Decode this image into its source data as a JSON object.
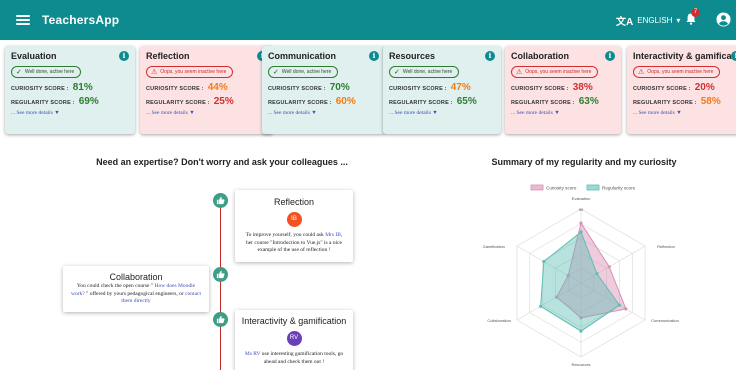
{
  "appbar": {
    "title": "TeachersApp",
    "language": "ENGLISH",
    "notification_count": "7"
  },
  "cards": [
    {
      "name": "Evaluation",
      "status": "good",
      "status_text": "Well done, active here",
      "curiosity_label": "CURIOSITY SCORE :",
      "curiosity": "81%",
      "curiosity_color": "green",
      "regularity_label": "REGULARITY SCORE :",
      "regularity": "69%",
      "regularity_color": "green",
      "more": "... See more details"
    },
    {
      "name": "Reflection",
      "status": "bad",
      "status_text": "Oops, you seem inactive here",
      "curiosity_label": "CURIOSITY SCORE :",
      "curiosity": "44%",
      "curiosity_color": "orange",
      "regularity_label": "REGULARITY SCORE :",
      "regularity": "25%",
      "regularity_color": "red",
      "more": "... See more details"
    },
    {
      "name": "Communication",
      "status": "good",
      "status_text": "Well done, active here",
      "curiosity_label": "CURIOSITY SCORE :",
      "curiosity": "70%",
      "curiosity_color": "green",
      "regularity_label": "REGULARITY SCORE :",
      "regularity": "60%",
      "regularity_color": "orange",
      "more": "... See more details"
    },
    {
      "name": "Resources",
      "status": "good",
      "status_text": "Well done, active here",
      "curiosity_label": "CURIOSITY SCORE :",
      "curiosity": "47%",
      "curiosity_color": "orange",
      "regularity_label": "REGULARITY SCORE :",
      "regularity": "65%",
      "regularity_color": "green",
      "more": "... See more details"
    },
    {
      "name": "Collaboration",
      "status": "bad",
      "status_text": "Oops, you seem inactive here",
      "curiosity_label": "CURIOSITY SCORE :",
      "curiosity": "38%",
      "curiosity_color": "red",
      "regularity_label": "REGULARITY SCORE :",
      "regularity": "63%",
      "regularity_color": "green",
      "more": "... See more details"
    },
    {
      "name": "Interactivity & gamification",
      "status": "bad",
      "status_text": "Oops, you seem inactive here",
      "curiosity_label": "CURIOSITY SCORE :",
      "curiosity": "20%",
      "curiosity_color": "red",
      "regularity_label": "REGULARITY SCORE :",
      "regularity": "58%",
      "regularity_color": "orange",
      "more": "... See more details"
    }
  ],
  "left_heading": "Need an expertise? Don't worry and ask your colleagues ...",
  "right_heading": "Summary of my regularity and my curiosity",
  "timeline": {
    "reflection": {
      "title": "Reflection",
      "avatar": "IB",
      "avatar_color": "#f4511e",
      "text_before": "To improve yourself, you could ask ",
      "link": "Mrs IB",
      "text_after": ", her course \"Introduction to Vue.js\" is a nice example of the use of reflection !"
    },
    "collaboration": {
      "title": "Collaboration",
      "text_before": "You could check the open course \" ",
      "link1": "How does Moodle work?",
      "text_middle": " \" offered by yours pedagogical engineers, or ",
      "link2": "contact them directly"
    },
    "interactivity": {
      "title": "Interactivity & gamification",
      "avatar": "RV",
      "avatar_color": "#6a3fb8",
      "link": "Ms RV",
      "text_after": " use interesting gamification tools, go ahead and check them out !"
    }
  },
  "chart_data": {
    "type": "radar",
    "categories": [
      "Evaluation",
      "Reflection",
      "Communication",
      "Resources",
      "Collaboration",
      "Gamification"
    ],
    "series": [
      {
        "name": "Curiosity score",
        "values": [
          81,
          44,
          70,
          47,
          38,
          20
        ],
        "color": "#d98fb5"
      },
      {
        "name": "Regularity score",
        "values": [
          69,
          25,
          60,
          65,
          63,
          58
        ],
        "color": "#5fbfb4"
      }
    ],
    "tick_label": "90",
    "max": 100,
    "legend": "top"
  }
}
